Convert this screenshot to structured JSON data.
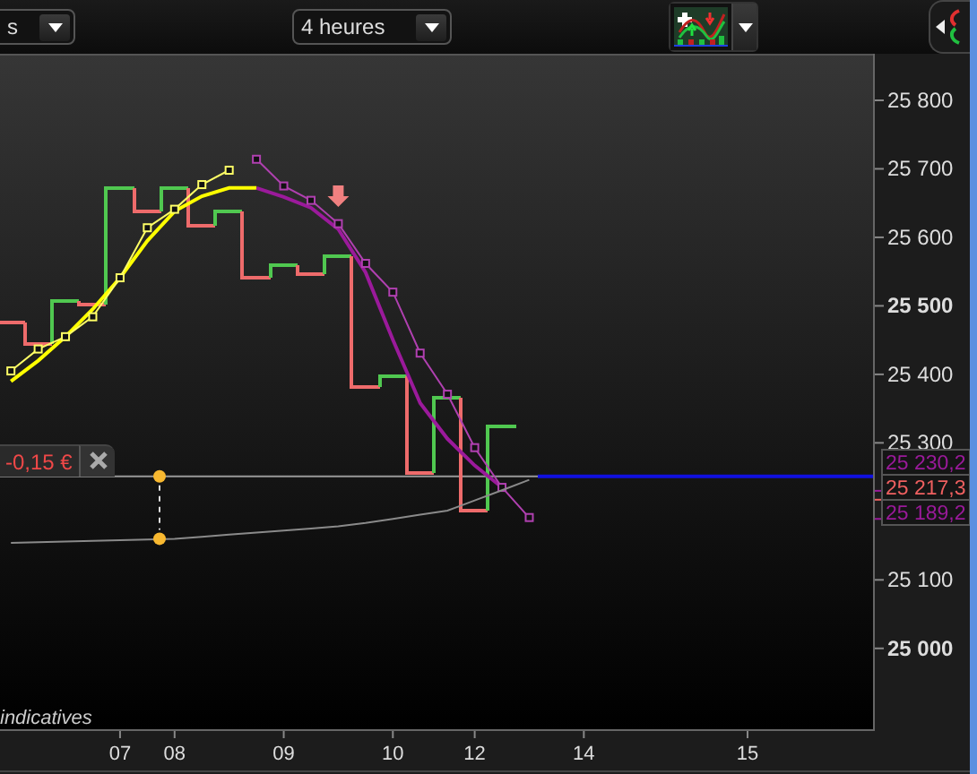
{
  "toolbar": {
    "range": {
      "value": "s"
    },
    "interval": {
      "value": "4 heures"
    }
  },
  "chart": {
    "chart_data": {
      "type": "line",
      "ylim": [
        24882,
        25868
      ],
      "yticks": [
        {
          "value": 25000,
          "label": "25 000"
        },
        {
          "value": 25100,
          "label": "25 100"
        },
        {
          "value": 25300,
          "label": "25 300"
        },
        {
          "value": 25400,
          "label": "25 400"
        },
        {
          "value": 25500,
          "label": "25 500"
        },
        {
          "value": 25600,
          "label": "25 600"
        },
        {
          "value": 25700,
          "label": "25 700"
        },
        {
          "value": 25800,
          "label": "25 800"
        }
      ],
      "categories": [
        null,
        null,
        null,
        null,
        "07",
        null,
        "08",
        null,
        null,
        null,
        "09",
        null,
        null,
        null,
        "10",
        null,
        null,
        "12",
        null,
        null,
        null,
        "14",
        null,
        null,
        null,
        null,
        null,
        "15",
        null,
        null,
        null,
        null
      ],
      "series": [
        {
          "color": "#ffff00",
          "values": [
            25390,
            25420,
            25455,
            25495,
            25541,
            25595,
            25638,
            25660,
            25672,
            25672,
            null,
            null,
            null,
            null,
            null,
            null,
            null,
            null,
            null,
            null,
            null,
            null,
            null,
            null,
            null,
            null,
            null,
            null,
            null,
            null,
            null,
            null
          ]
        },
        {
          "color": "#ffff66",
          "marker": "square",
          "values": [
            25405,
            25437,
            25455,
            25484,
            25541,
            25614,
            25641,
            25677,
            25698,
            null,
            null,
            null,
            null,
            null,
            null,
            null,
            null,
            null,
            null,
            null,
            null,
            null,
            null,
            null,
            null,
            null,
            null,
            null,
            null,
            null,
            null,
            null
          ]
        },
        {
          "color": "#9b1a9b",
          "values": [
            null,
            null,
            null,
            null,
            null,
            null,
            null,
            null,
            null,
            25672,
            25659,
            25643,
            25612,
            25549,
            25450,
            25358,
            25306,
            25267,
            25235,
            null,
            null,
            null,
            null,
            null,
            null,
            null,
            null,
            null,
            null,
            null,
            null,
            null
          ]
        },
        {
          "color": "#b040b0",
          "marker": "square",
          "values": [
            null,
            null,
            null,
            null,
            null,
            null,
            null,
            null,
            null,
            25714,
            25675,
            25654,
            25620,
            25562,
            25520,
            25431,
            25371,
            25293,
            25235,
            25191,
            null,
            null,
            null,
            null,
            null,
            null,
            null,
            null,
            null,
            null,
            null,
            null
          ]
        },
        {
          "color": "#8a8a8a",
          "values": [
            25154,
            25155,
            25156,
            25157,
            25158,
            25159,
            25160,
            25163,
            25166,
            25169,
            25172,
            25175,
            25178,
            25183,
            25189,
            25195,
            25201,
            25216,
            25231,
            25246,
            null,
            null,
            null,
            null,
            null,
            null,
            null,
            null,
            null,
            null,
            null,
            null
          ]
        }
      ]
    },
    "level_label": "-0,15 €",
    "price_tags": [
      {
        "text": "25 230,2",
        "color": "#9a1a9a"
      },
      {
        "text": "25 217,3",
        "color": "#f06060"
      },
      {
        "text": "25 189,2",
        "color": "#9a1a9a"
      }
    ],
    "footnote": "indicatives"
  }
}
